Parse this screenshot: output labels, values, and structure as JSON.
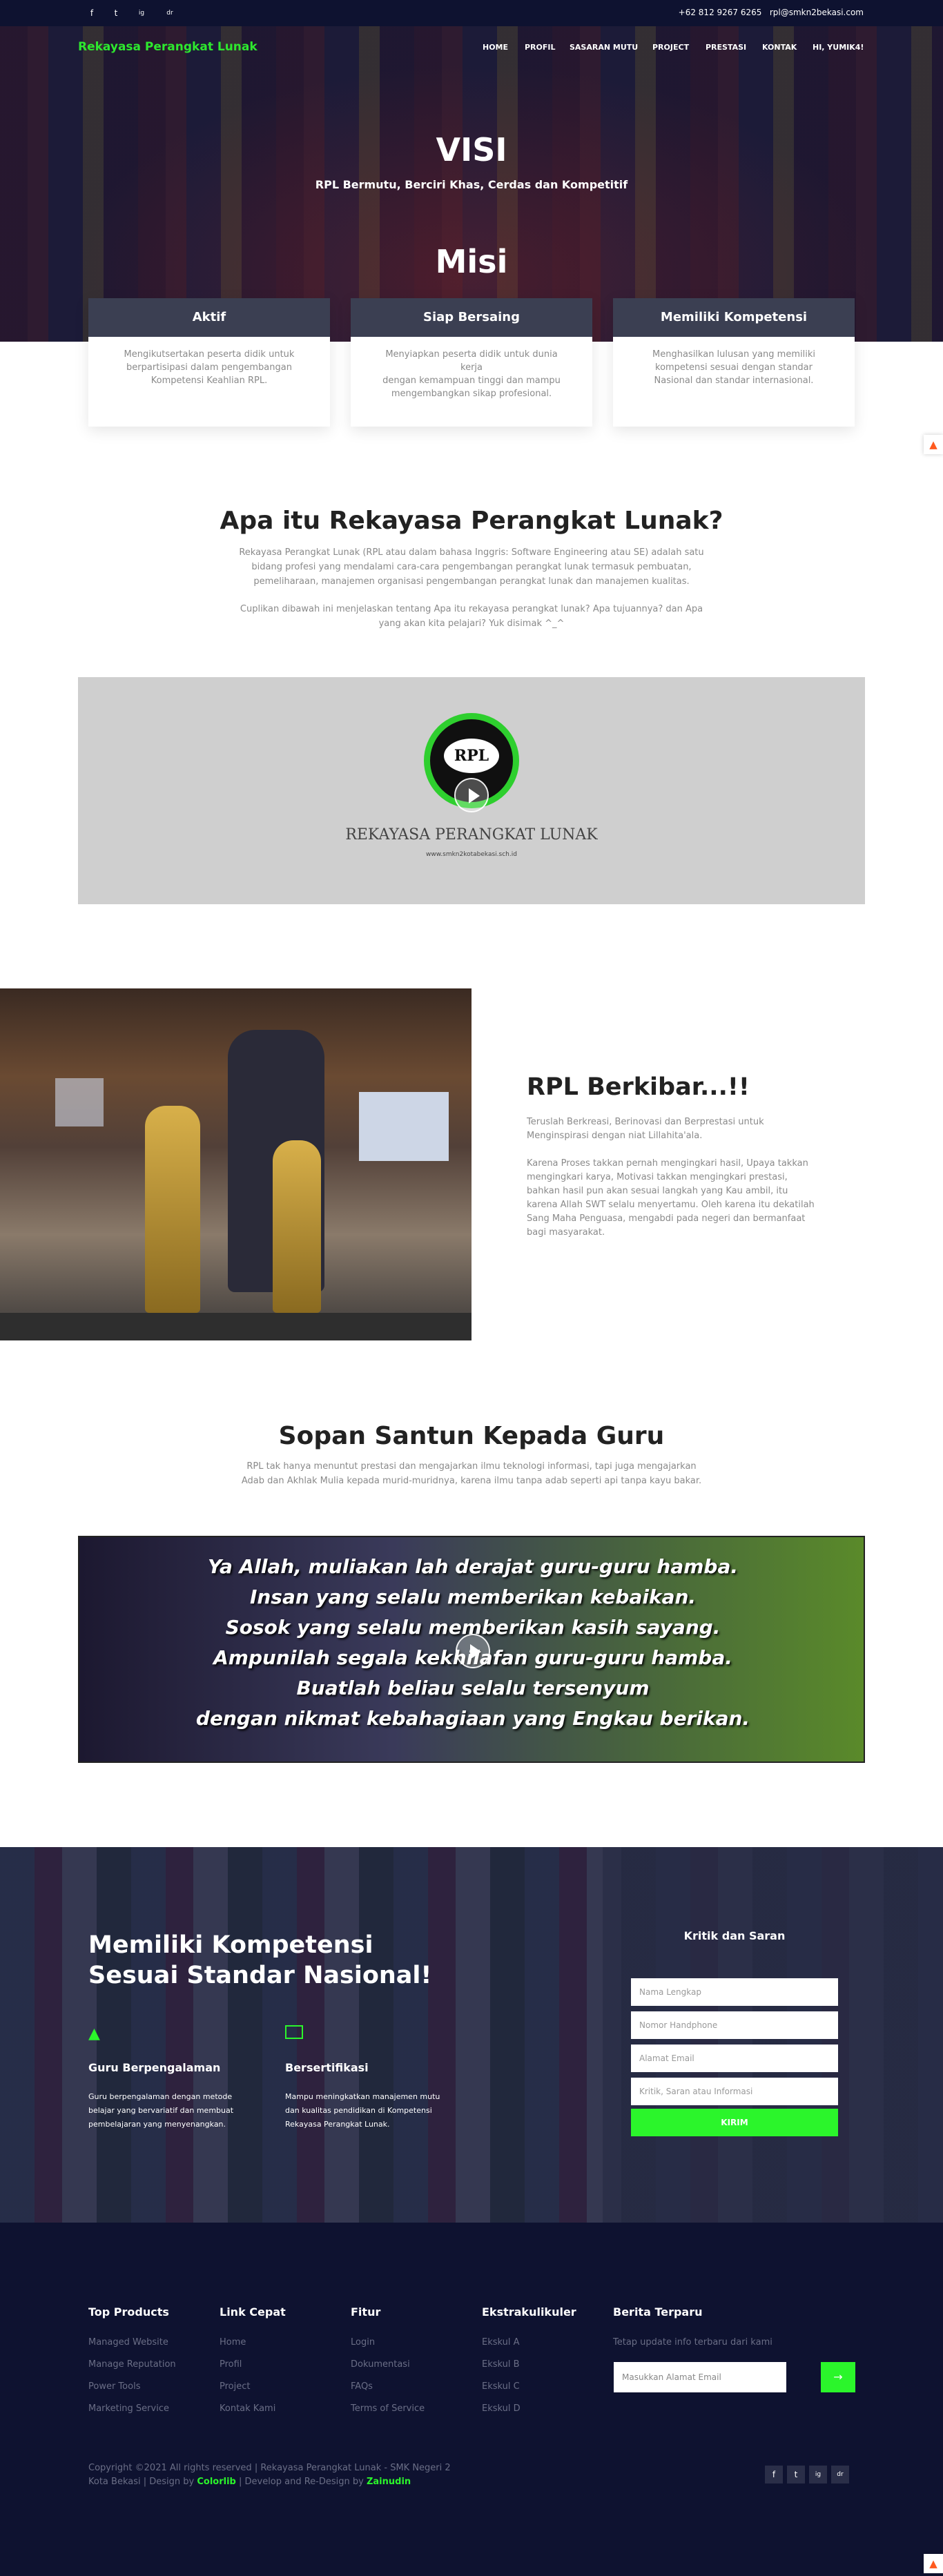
{
  "topbar": {
    "social": [
      "f",
      "t",
      "ig",
      "dr"
    ],
    "phone": "+62 812 9267 6265",
    "email": "rpl@smkn2bekasi.com"
  },
  "brand": "Rekayasa Perangkat Lunak",
  "nav": [
    "HOME",
    "PROFIL",
    "SASARAN MUTU",
    "PROJECT",
    "PRESTASI",
    "KONTAK",
    "HI, YUMIK4!"
  ],
  "visi": {
    "title": "VISI",
    "text": "RPL Bermutu, Berciri Khas, Cerdas dan Kompetitif"
  },
  "misi": {
    "title": "Misi",
    "cards": [
      {
        "title": "Aktif",
        "lines": [
          "Mengikutsertakan peserta didik untuk",
          "berpartisipasi dalam pengembangan",
          "Kompetensi Keahlian RPL."
        ]
      },
      {
        "title": "Siap Bersaing",
        "lines": [
          "Menyiapkan peserta didik untuk dunia kerja",
          "dengan kemampuan tinggi dan mampu",
          "mengembangkan sikap profesional."
        ]
      },
      {
        "title": "Memiliki Kompetensi",
        "lines": [
          "Menghasilkan lulusan yang memiliki",
          "kompetensi sesuai dengan standar",
          "Nasional dan standar internasional."
        ]
      }
    ]
  },
  "about": {
    "title": "Apa itu Rekayasa Perangkat Lunak?",
    "p1": [
      "Rekayasa Perangkat Lunak (RPL atau dalam bahasa Inggris: Software Engineering atau SE) adalah satu",
      "bidang profesi yang mendalami cara-cara pengembangan perangkat lunak termasuk pembuatan,",
      "pemeliharaan, manajemen organisasi pengembangan perangkat lunak dan manajemen kualitas."
    ],
    "p2": [
      "Cuplikan dibawah ini menjelaskan tentang Apa itu rekayasa perangkat lunak? Apa tujuannya? dan Apa",
      "yang akan kita pelajari? Yuk disimak ^_^"
    ]
  },
  "video1": {
    "logo_text": "RPL",
    "caption": "REKAYASA PERANGKAT LUNAK",
    "url_text": "www.smkn2kotabekasi.sch.id"
  },
  "rpl": {
    "title": "RPL Berkibar...!!",
    "p1": [
      "Teruslah Berkreasi, Berinovasi dan Berprestasi untuk",
      "Menginspirasi dengan niat Lillahita'ala."
    ],
    "p2": [
      "Karena Proses takkan pernah mengingkari hasil, Upaya takkan",
      "mengingkari karya, Motivasi takkan mengingkari prestasi,",
      "bahkan hasil pun akan sesuai langkah yang Kau ambil, itu",
      "karena Allah SWT selalu menyertamu. Oleh karena itu dekatilah",
      "Sang Maha Penguasa, mengabdi pada negeri dan bermanfaat",
      "bagi masyarakat."
    ]
  },
  "sopan": {
    "title": "Sopan Santun Kepada Guru",
    "lines": [
      "RPL tak hanya menuntut prestasi dan mengajarkan ilmu teknologi informasi, tapi juga mengajarkan",
      "Adab dan Akhlak Mulia kepada murid-muridnya, karena ilmu tanpa adab seperti api tanpa kayu bakar."
    ],
    "quote": [
      "Ya Allah, muliakan lah derajat guru-guru hamba.",
      "Insan yang selalu memberikan kebaikan.",
      "Sosok yang selalu memberikan kasih sayang.",
      "Ampunilah segala kekhilafan guru-guru hamba.",
      "Buatlah beliau selalu tersenyum",
      "dengan nikmat kebahagiaan yang Engkau berikan."
    ]
  },
  "competence": {
    "title_lines": [
      "Memiliki Kompetensi",
      "Sesuai Standar Nasional!"
    ],
    "features": [
      {
        "title": "Guru Berpengalaman",
        "icon": "graduation-cap-icon",
        "lines": [
          "Guru berpengalaman dengan metode",
          "belajar yang bervariatif dan membuat",
          "pembelajaran yang menyenangkan."
        ]
      },
      {
        "title": "Bersertifikasi",
        "icon": "certificate-icon",
        "lines": [
          "Mampu meningkatkan manajemen mutu",
          "dan kualitas pendidikan di Kompetensi",
          "Rekayasa Perangkat Lunak."
        ]
      }
    ],
    "form": {
      "title": "Kritik dan Saran",
      "fields": [
        "Nama Lengkap",
        "Nomor Handphone",
        "Alamat Email",
        "Kritik, Saran atau Informasi"
      ],
      "submit": "KIRIM"
    }
  },
  "footer": {
    "columns": [
      {
        "title": "Top Products",
        "links": [
          "Managed Website",
          "Manage Reputation",
          "Power Tools",
          "Marketing Service"
        ]
      },
      {
        "title": "Link Cepat",
        "links": [
          "Home",
          "Profil",
          "Project",
          "Kontak Kami"
        ]
      },
      {
        "title": "Fitur",
        "links": [
          "Login",
          "Dokumentasi",
          "FAQs",
          "Terms of Service"
        ]
      },
      {
        "title": "Ekstrakulikuler",
        "links": [
          "Ekskul A",
          "Ekskul B",
          "Ekskul C",
          "Ekskul D"
        ]
      }
    ],
    "news": {
      "title": "Berita Terparu",
      "text": "Tetap update info terbaru dari kami",
      "placeholder": "Masukkan Alamat Email",
      "button": "→"
    },
    "copyright_line1": "Copyright ©2021 All rights reserved | Rekayasa Perangkat Lunak - SMK Negeri 2",
    "copyright_pre": "Kota Bekasi | Design by ",
    "colorlib": "Colorlib",
    "copyright_mid": " | Develop and Re-Design by ",
    "author": "Zainudin",
    "social": [
      "f",
      "t",
      "ig",
      "dr"
    ]
  },
  "colors": {
    "accent": "#2bf52b",
    "navy": "#0e1230"
  }
}
